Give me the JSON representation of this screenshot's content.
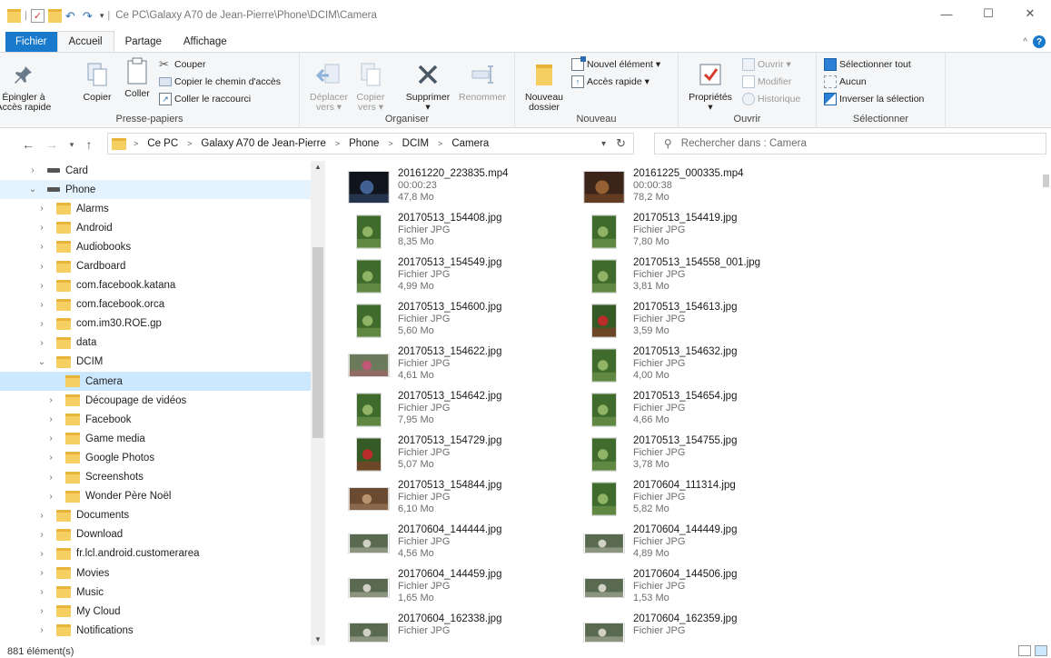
{
  "window": {
    "title": "Ce PC\\Galaxy A70 de Jean-Pierre\\Phone\\DCIM\\Camera",
    "minimize": "—",
    "maximize": "☐",
    "close": "✕"
  },
  "tabs": [
    {
      "label": "Fichier"
    },
    {
      "label": "Accueil"
    },
    {
      "label": "Partage"
    },
    {
      "label": "Affichage"
    }
  ],
  "ribbon": {
    "presse_papiers": {
      "label": "Presse-papiers",
      "pin": "Épingler à\nAccès rapide",
      "copy": "Copier",
      "paste": "Coller",
      "cut": "Couper",
      "copy_path": "Copier le chemin d'accès",
      "paste_shortcut": "Coller le raccourci"
    },
    "organiser": {
      "label": "Organiser",
      "move": "Déplacer\nvers ▾",
      "copy_to": "Copier\nvers ▾",
      "delete": "Supprimer\n▾",
      "rename": "Renommer"
    },
    "nouveau": {
      "label": "Nouveau",
      "new_folder": "Nouveau\ndossier",
      "new_item": "Nouvel élément ▾",
      "easy_access": "Accès rapide ▾"
    },
    "ouvrir": {
      "label": "Ouvrir",
      "properties": "Propriétés\n▾",
      "open": "Ouvrir ▾",
      "edit": "Modifier",
      "history": "Historique"
    },
    "selectionner": {
      "label": "Sélectionner",
      "select_all": "Sélectionner tout",
      "select_none": "Aucun",
      "invert": "Inverser la sélection"
    }
  },
  "address": {
    "crumbs": [
      "Ce PC",
      "Galaxy A70 de Jean-Pierre",
      "Phone",
      "DCIM",
      "Camera"
    ],
    "search_placeholder": "Rechercher dans : Camera"
  },
  "tree": [
    {
      "label": "Card",
      "level": 1,
      "type": "drive",
      "twisty": ">"
    },
    {
      "label": "Phone",
      "level": 1,
      "type": "drive",
      "twisty": "v",
      "state": "hl"
    },
    {
      "label": "Alarms",
      "level": 2,
      "type": "folder",
      "twisty": ">"
    },
    {
      "label": "Android",
      "level": 2,
      "type": "folder",
      "twisty": ">"
    },
    {
      "label": "Audiobooks",
      "level": 2,
      "type": "folder",
      "twisty": ">"
    },
    {
      "label": "Cardboard",
      "level": 2,
      "type": "folder",
      "twisty": ">"
    },
    {
      "label": "com.facebook.katana",
      "level": 2,
      "type": "folder",
      "twisty": ">"
    },
    {
      "label": "com.facebook.orca",
      "level": 2,
      "type": "folder",
      "twisty": ">"
    },
    {
      "label": "com.im30.ROE.gp",
      "level": 2,
      "type": "folder",
      "twisty": ">"
    },
    {
      "label": "data",
      "level": 2,
      "type": "folder",
      "twisty": ">"
    },
    {
      "label": "DCIM",
      "level": 2,
      "type": "folder",
      "twisty": "v"
    },
    {
      "label": "Camera",
      "level": 3,
      "type": "folder",
      "twisty": "",
      "state": "sel"
    },
    {
      "label": "Découpage de vidéos",
      "level": 3,
      "type": "folder",
      "twisty": ">"
    },
    {
      "label": "Facebook",
      "level": 3,
      "type": "folder",
      "twisty": ">"
    },
    {
      "label": "Game media",
      "level": 3,
      "type": "folder",
      "twisty": ">"
    },
    {
      "label": "Google Photos",
      "level": 3,
      "type": "folder",
      "twisty": ">"
    },
    {
      "label": "Screenshots",
      "level": 3,
      "type": "folder",
      "twisty": ">"
    },
    {
      "label": "Wonder Père Noël",
      "level": 3,
      "type": "folder",
      "twisty": ">"
    },
    {
      "label": "Documents",
      "level": 2,
      "type": "folder",
      "twisty": ">"
    },
    {
      "label": "Download",
      "level": 2,
      "type": "folder",
      "twisty": ">"
    },
    {
      "label": "fr.lcl.android.customerarea",
      "level": 2,
      "type": "folder",
      "twisty": ">"
    },
    {
      "label": "Movies",
      "level": 2,
      "type": "folder",
      "twisty": ">"
    },
    {
      "label": "Music",
      "level": 2,
      "type": "folder",
      "twisty": ">"
    },
    {
      "label": "My Cloud",
      "level": 2,
      "type": "folder",
      "twisty": ">"
    },
    {
      "label": "Notifications",
      "level": 2,
      "type": "folder",
      "twisty": ">"
    }
  ],
  "files": [
    {
      "name": "20161220_223835.mp4",
      "line2": "00:00:23",
      "line3": "47,8 Mo",
      "thumb": "video-dark"
    },
    {
      "name": "20161225_000335.mp4",
      "line2": "00:00:38",
      "line3": "78,2 Mo",
      "thumb": "video-warm"
    },
    {
      "name": "20170513_154408.jpg",
      "line2": "Fichier JPG",
      "line3": "8,35 Mo",
      "thumb": "portrait-green"
    },
    {
      "name": "20170513_154419.jpg",
      "line2": "Fichier JPG",
      "line3": "7,80 Mo",
      "thumb": "portrait-green"
    },
    {
      "name": "20170513_154549.jpg",
      "line2": "Fichier JPG",
      "line3": "4,99 Mo",
      "thumb": "portrait-green"
    },
    {
      "name": "20170513_154558_001.jpg",
      "line2": "Fichier JPG",
      "line3": "3,81 Mo",
      "thumb": "portrait-green"
    },
    {
      "name": "20170513_154600.jpg",
      "line2": "Fichier JPG",
      "line3": "5,60 Mo",
      "thumb": "portrait-green"
    },
    {
      "name": "20170513_154613.jpg",
      "line2": "Fichier JPG",
      "line3": "3,59 Mo",
      "thumb": "portrait-red"
    },
    {
      "name": "20170513_154622.jpg",
      "line2": "Fichier JPG",
      "line3": "4,61 Mo",
      "thumb": "landscape-pink"
    },
    {
      "name": "20170513_154632.jpg",
      "line2": "Fichier JPG",
      "line3": "4,00 Mo",
      "thumb": "portrait-green"
    },
    {
      "name": "20170513_154642.jpg",
      "line2": "Fichier JPG",
      "line3": "7,95 Mo",
      "thumb": "portrait-green"
    },
    {
      "name": "20170513_154654.jpg",
      "line2": "Fichier JPG",
      "line3": "4,66 Mo",
      "thumb": "portrait-green"
    },
    {
      "name": "20170513_154729.jpg",
      "line2": "Fichier JPG",
      "line3": "5,07 Mo",
      "thumb": "portrait-red"
    },
    {
      "name": "20170513_154755.jpg",
      "line2": "Fichier JPG",
      "line3": "3,78 Mo",
      "thumb": "portrait-green"
    },
    {
      "name": "20170513_154844.jpg",
      "line2": "Fichier JPG",
      "line3": "6,10 Mo",
      "thumb": "landscape-brown"
    },
    {
      "name": "20170604_111314.jpg",
      "line2": "Fichier JPG",
      "line3": "5,82 Mo",
      "thumb": "portrait-green"
    },
    {
      "name": "20170604_144444.jpg",
      "line2": "Fichier JPG",
      "line3": "4,56 Mo",
      "thumb": "landscape-crowd"
    },
    {
      "name": "20170604_144449.jpg",
      "line2": "Fichier JPG",
      "line3": "4,89 Mo",
      "thumb": "landscape-crowd"
    },
    {
      "name": "20170604_144459.jpg",
      "line2": "Fichier JPG",
      "line3": "1,65 Mo",
      "thumb": "landscape-crowd"
    },
    {
      "name": "20170604_144506.jpg",
      "line2": "Fichier JPG",
      "line3": "1,53 Mo",
      "thumb": "landscape-crowd"
    },
    {
      "name": "20170604_162338.jpg",
      "line2": "Fichier JPG",
      "line3": "",
      "thumb": "landscape-crowd"
    },
    {
      "name": "20170604_162359.jpg",
      "line2": "Fichier JPG",
      "line3": "",
      "thumb": "landscape-crowd"
    }
  ],
  "status": {
    "count": "881 élément(s)"
  },
  "colors": {
    "accent": "#1979ca",
    "selection": "#cce8ff",
    "folder": "#f6cf63"
  }
}
